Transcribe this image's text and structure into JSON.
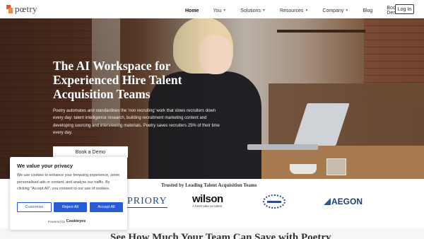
{
  "header": {
    "logo_text": "pœtry",
    "nav": [
      {
        "label": "Home",
        "active": true,
        "has_dropdown": false
      },
      {
        "label": "You",
        "active": false,
        "has_dropdown": true
      },
      {
        "label": "Solutions",
        "active": false,
        "has_dropdown": true
      },
      {
        "label": "Resources",
        "active": false,
        "has_dropdown": true
      },
      {
        "label": "Company",
        "active": false,
        "has_dropdown": true
      },
      {
        "label": "Blog",
        "active": false,
        "has_dropdown": false
      },
      {
        "label": "Book a Demo",
        "active": false,
        "has_dropdown": false
      }
    ],
    "login_label": "Log In"
  },
  "hero": {
    "title": "The AI Workspace for Experienced Hire Talent Acquisition Teams",
    "description": "Poetry automates and standardises the 'non recruiting' work that slows recruiters down every day: talent intelligence research, building recruitment marketing content and developing sourcing and interviewing materials. Poetry saves recruiters 25% of their time every day.",
    "cta_label": "Book a Demo"
  },
  "trusted": {
    "title": "Trusted by Leading Talent Acquisition Teams",
    "logos": {
      "priory": "PRIORY",
      "wilson": "wilson",
      "wilson_tagline": "A fresh take on talent",
      "aegon": "AEGON"
    }
  },
  "savings": {
    "title": "See How Much Your Team Can Save with Poetry"
  },
  "cookie": {
    "title": "We value your privacy",
    "text": "We use cookies to enhance your browsing experience, serve personalised ads or content, and analyse our traffic. By clicking \"Accept All\", you consent to our use of cookies.",
    "customise_label": "Customise",
    "reject_label": "Reject All",
    "accept_label": "Accept All",
    "powered_by": "Powered by",
    "powered_brand": "Cookieyes"
  },
  "colors": {
    "accent_blue": "#2a5bd7",
    "logo_orange": "#e8522d"
  }
}
